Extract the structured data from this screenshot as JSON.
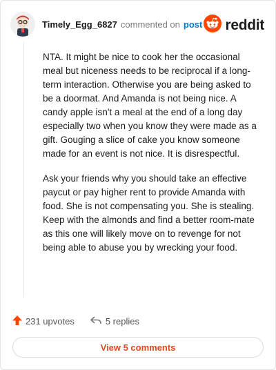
{
  "comment": {
    "username": "Timely_Egg_6827",
    "action_text": "commented on",
    "post_link": "post",
    "paragraphs": [
      "NTA. It might be nice to cook her the occasional meal but niceness needs to be reciprocal if a long-term interaction. Otherwise you are being asked to be a doormat. And Amanda is not being nice. A candy apple isn't a meal at the end of a long day especially two when you know they were made as a gift. Gouging a slice of cake you know someone made for an event is not nice. It is disrespectful.",
      "Ask your friends why you should take an effective paycut or pay higher rent to provide Amanda with food. She is not compensating you. She is stealing. Keep with the almonds and find a better room-mate as this one will likely move on to revenge for not being able to abuse you by wrecking your food."
    ],
    "upvotes": "231 upvotes",
    "replies": "5 replies",
    "view_comments": "View 5 comments"
  },
  "brand": {
    "name": "reddit",
    "accent": "#ff4500"
  },
  "icons": {
    "avatar": "avatar-icon",
    "logo": "reddit-logo-icon",
    "upvote": "upvote-arrow-icon",
    "reply": "reply-arrow-icon"
  }
}
